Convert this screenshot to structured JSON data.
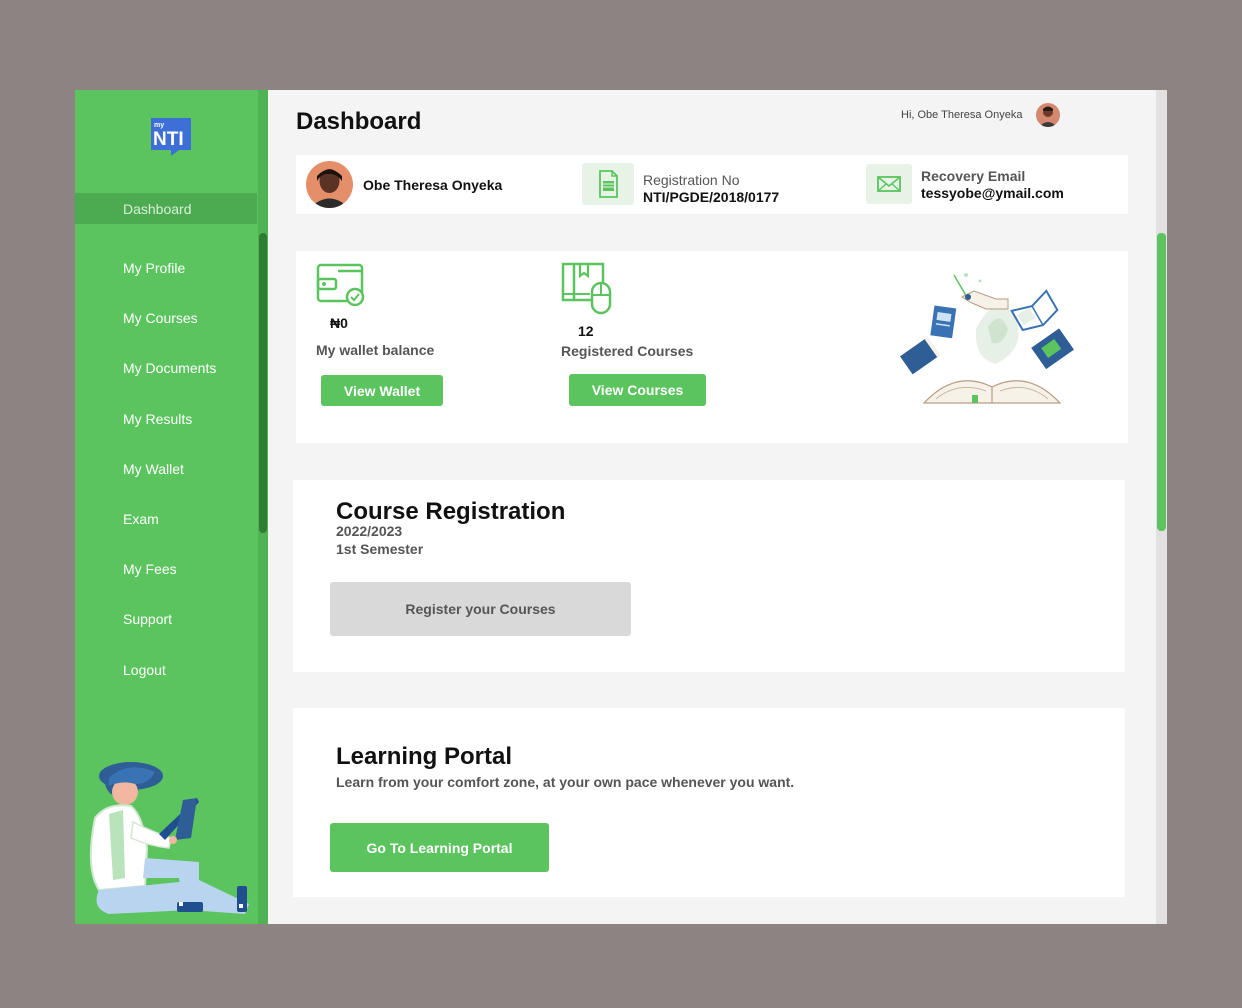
{
  "sidebar": {
    "logo_text": "NTI",
    "logo_small": "my",
    "items": [
      {
        "label": "Dashboard",
        "active": true
      },
      {
        "label": "My Profile"
      },
      {
        "label": "My Courses"
      },
      {
        "label": "My Documents"
      },
      {
        "label": "My Results"
      },
      {
        "label": "My Wallet"
      },
      {
        "label": "Exam"
      },
      {
        "label": "My Fees"
      },
      {
        "label": "Support"
      },
      {
        "label": "Logout"
      }
    ]
  },
  "header": {
    "title": "Dashboard",
    "greeting": "Hi, Obe Theresa Onyeka"
  },
  "profile": {
    "name": "Obe Theresa Onyeka",
    "registration_label": "Registration No",
    "registration_no": "NTI/PGDE/2018/0177",
    "email_label": "Recovery Email",
    "email": "tessyobe@ymail.com"
  },
  "stats": {
    "wallet_amount": "₦0",
    "wallet_label": "My wallet balance",
    "wallet_button": "View Wallet",
    "courses_count": "12",
    "courses_label": "Registered Courses",
    "courses_button": "View Courses"
  },
  "course_registration": {
    "title": "Course Registration",
    "session": "2022/2023",
    "semester": "1st Semester",
    "button": "Register your Courses"
  },
  "learning_portal": {
    "title": "Learning Portal",
    "subtitle": "Learn from your comfort zone, at your own pace whenever you want.",
    "button": "Go To Learning Portal"
  },
  "colors": {
    "brand_green": "#5bc45f",
    "logo_blue": "#3d6fd6",
    "background": "#8c8382"
  },
  "icons": [
    "wallet-icon",
    "document-icon",
    "mail-icon",
    "books-icon"
  ]
}
